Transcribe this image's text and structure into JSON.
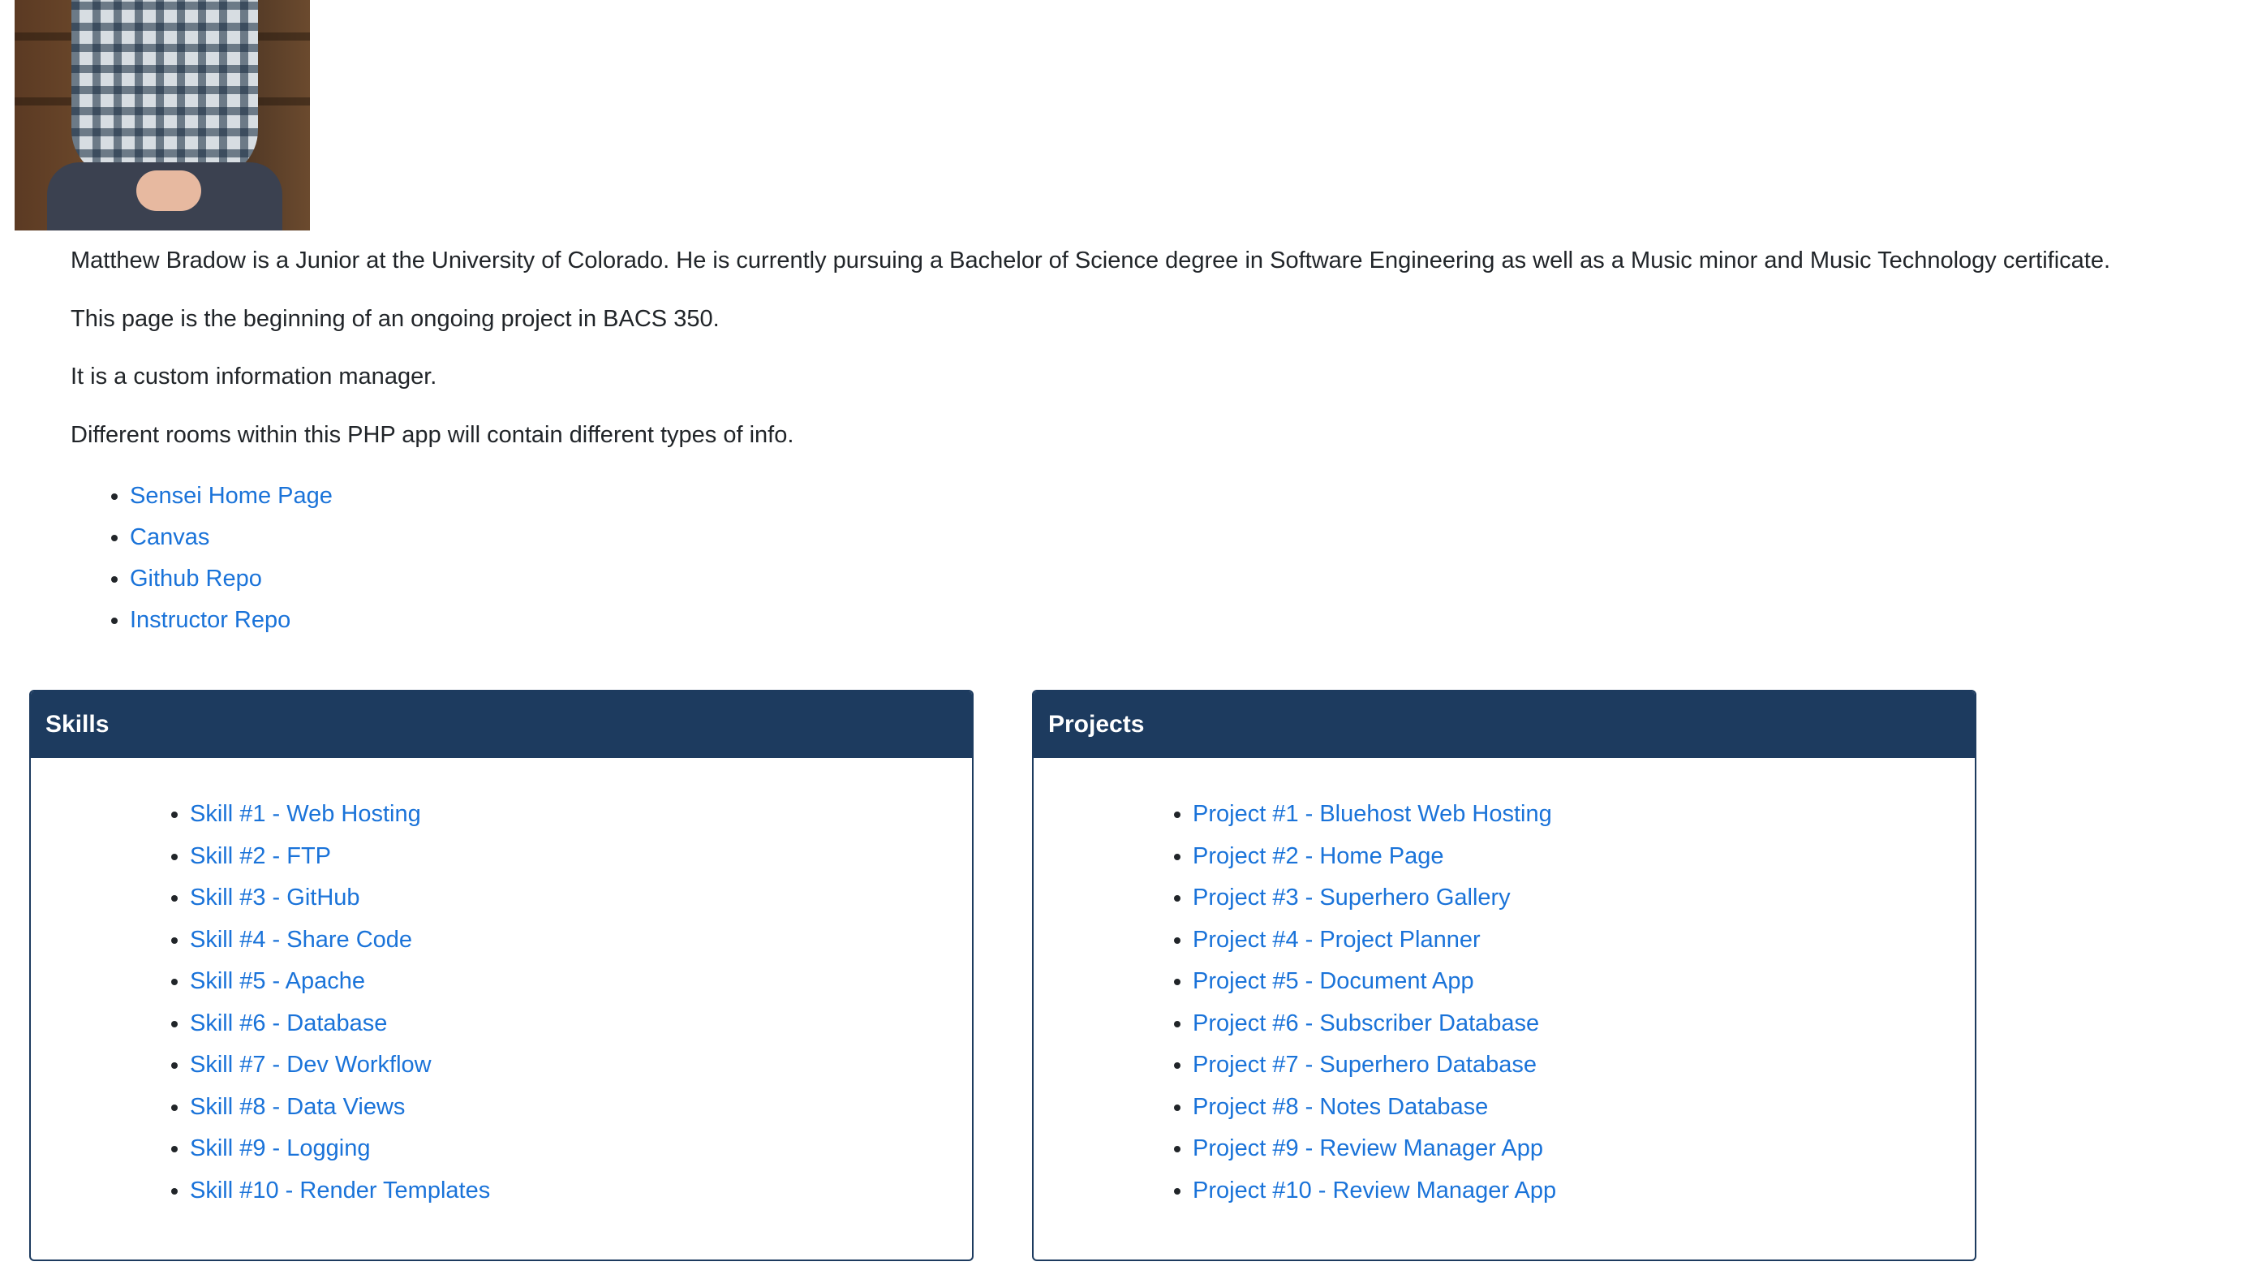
{
  "profile": {
    "photo_alt": "Matthew Bradow photo"
  },
  "bio": {
    "paragraphs": [
      "Matthew Bradow is a Junior at the University of Colorado. He is currently pursuing a Bachelor of Science degree in Software Engineering as well as a Music minor and Music Technology certificate.",
      "This page is the beginning of an ongoing project in BACS 350.",
      "It is a custom information manager.",
      "Different rooms within this PHP app will contain different types of info."
    ],
    "links": [
      "Sensei Home Page",
      "Canvas",
      "Github Repo",
      "Instructor Repo"
    ]
  },
  "skills": {
    "title": "Skills",
    "items": [
      "Skill #1 - Web Hosting",
      "Skill #2 - FTP",
      "Skill #3 - GitHub",
      "Skill #4 - Share Code",
      "Skill #5 - Apache",
      "Skill #6 - Database",
      "Skill #7 - Dev Workflow",
      "Skill #8 - Data Views",
      "Skill #9 - Logging",
      "Skill #10 - Render Templates"
    ]
  },
  "projects": {
    "title": "Projects",
    "items": [
      "Project #1 - Bluehost Web Hosting",
      "Project #2 - Home Page",
      "Project #3 - Superhero Gallery",
      "Project #4 - Project Planner",
      "Project #5 - Document App",
      "Project #6 - Subscriber Database",
      "Project #7 - Superhero Database",
      "Project #8 - Notes Database",
      "Project #9 - Review Manager App",
      "Project #10 - Review Manager App"
    ]
  },
  "colors": {
    "header_bg": "#1d3b5f",
    "link": "#1a73d9",
    "text": "#212529"
  }
}
